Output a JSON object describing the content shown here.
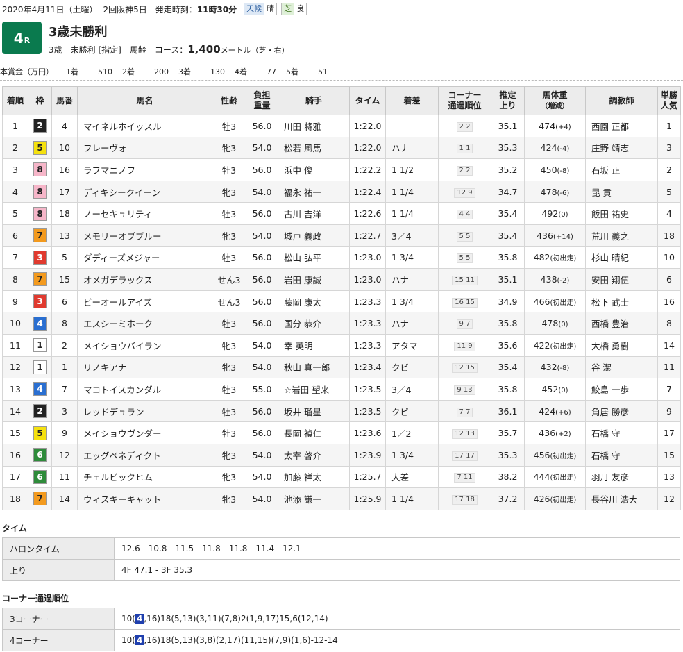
{
  "header": {
    "date": "2020年4月11日（土曜）",
    "meeting": "2回阪神5日",
    "post_time_label": "発走時刻：",
    "post_time": "11時30分",
    "weather_label": "天候",
    "weather": "晴",
    "turf_label": "芝",
    "going": "良"
  },
  "race": {
    "number": "4",
    "suffix": "R",
    "title": "3歳未勝利",
    "conditions": "3歳　未勝利 [指定]　馬齢",
    "course_label": "コース：",
    "distance": "1,400",
    "course_detail": "メートル（芝・右）"
  },
  "prize": {
    "label": "本賞金（万円）",
    "items": [
      {
        "place": "1着",
        "amount": "510"
      },
      {
        "place": "2着",
        "amount": "200"
      },
      {
        "place": "3着",
        "amount": "130"
      },
      {
        "place": "4着",
        "amount": "77"
      },
      {
        "place": "5着",
        "amount": "51"
      }
    ]
  },
  "columns": [
    "着順",
    "枠",
    "馬番",
    "馬名",
    "性齢",
    "負担重量",
    "騎手",
    "タイム",
    "着差",
    "コーナー通過順位",
    "推定上り",
    "馬体重（増減）",
    "調教師",
    "単勝人気"
  ],
  "colors": {
    "waku": {
      "1": {
        "bg": "#ffffff",
        "fg": "#222222"
      },
      "2": {
        "bg": "#222222",
        "fg": "#ffffff"
      },
      "3": {
        "bg": "#e03a2f",
        "fg": "#ffffff"
      },
      "4": {
        "bg": "#2a6fd1",
        "fg": "#ffffff"
      },
      "5": {
        "bg": "#f5e10f",
        "fg": "#222222"
      },
      "6": {
        "bg": "#2e8b3a",
        "fg": "#ffffff"
      },
      "7": {
        "bg": "#f39a1e",
        "fg": "#222222"
      },
      "8": {
        "bg": "#f6b6c9",
        "fg": "#222222"
      }
    },
    "race_badge": "#0a7a4e",
    "highlight": "#1f3fae"
  },
  "results": [
    {
      "pos": "1",
      "waku": "2",
      "num": "4",
      "name": "マイネルホイッスル",
      "sex_age": "牡3",
      "weight": "56.0",
      "jockey": "川田 将雅",
      "time": "1:22.0",
      "margin": "",
      "corner": "2 2",
      "last3f": "35.1",
      "body": "474",
      "diff": "(+4)",
      "trainer": "西園 正都",
      "pop": "1"
    },
    {
      "pos": "2",
      "waku": "5",
      "num": "10",
      "name": "フレーヴォ",
      "sex_age": "牝3",
      "weight": "54.0",
      "jockey": "松若 風馬",
      "time": "1:22.0",
      "margin": "ハナ",
      "corner": "1 1",
      "last3f": "35.3",
      "body": "424",
      "diff": "(-4)",
      "trainer": "庄野 靖志",
      "pop": "3"
    },
    {
      "pos": "3",
      "waku": "8",
      "num": "16",
      "name": "ラフマニノフ",
      "sex_age": "牡3",
      "weight": "56.0",
      "jockey": "浜中 俊",
      "time": "1:22.2",
      "margin": "1 1/2",
      "corner": "2 2",
      "last3f": "35.2",
      "body": "450",
      "diff": "(-8)",
      "trainer": "石坂 正",
      "pop": "2"
    },
    {
      "pos": "4",
      "waku": "8",
      "num": "17",
      "name": "ディキシークイーン",
      "sex_age": "牝3",
      "weight": "54.0",
      "jockey": "福永 祐一",
      "time": "1:22.4",
      "margin": "1 1/4",
      "corner": "12 9",
      "last3f": "34.7",
      "body": "478",
      "diff": "(-6)",
      "trainer": "昆 貢",
      "pop": "5"
    },
    {
      "pos": "5",
      "waku": "8",
      "num": "18",
      "name": "ノーセキュリティ",
      "sex_age": "牡3",
      "weight": "56.0",
      "jockey": "古川 吉洋",
      "time": "1:22.6",
      "margin": "1 1/4",
      "corner": "4 4",
      "last3f": "35.4",
      "body": "492",
      "diff": "(0)",
      "trainer": "飯田 祐史",
      "pop": "4"
    },
    {
      "pos": "6",
      "waku": "7",
      "num": "13",
      "name": "メモリーオブブルー",
      "sex_age": "牝3",
      "weight": "54.0",
      "jockey": "城戸 義政",
      "time": "1:22.7",
      "margin": "3／4",
      "corner": "5 5",
      "last3f": "35.4",
      "body": "436",
      "diff": "(+14)",
      "trainer": "荒川 義之",
      "pop": "18"
    },
    {
      "pos": "7",
      "waku": "3",
      "num": "5",
      "name": "ダディーズメジャー",
      "sex_age": "牡3",
      "weight": "56.0",
      "jockey": "松山 弘平",
      "time": "1:23.0",
      "margin": "1 3/4",
      "corner": "5 5",
      "last3f": "35.8",
      "body": "482",
      "diff": "(初出走)",
      "trainer": "杉山 晴紀",
      "pop": "10"
    },
    {
      "pos": "8",
      "waku": "7",
      "num": "15",
      "name": "オメガデラックス",
      "sex_age": "せん3",
      "weight": "56.0",
      "jockey": "岩田 康誠",
      "time": "1:23.0",
      "margin": "ハナ",
      "corner": "15 11",
      "last3f": "35.1",
      "body": "438",
      "diff": "(-2)",
      "trainer": "安田 翔伍",
      "pop": "6"
    },
    {
      "pos": "9",
      "waku": "3",
      "num": "6",
      "name": "ビーオールアイズ",
      "sex_age": "せん3",
      "weight": "56.0",
      "jockey": "藤岡 康太",
      "time": "1:23.3",
      "margin": "1 3/4",
      "corner": "16 15",
      "last3f": "34.9",
      "body": "466",
      "diff": "(初出走)",
      "trainer": "松下 武士",
      "pop": "16"
    },
    {
      "pos": "10",
      "waku": "4",
      "num": "8",
      "name": "エスシーミホーク",
      "sex_age": "牡3",
      "weight": "56.0",
      "jockey": "国分 恭介",
      "time": "1:23.3",
      "margin": "ハナ",
      "corner": "9 7",
      "last3f": "35.8",
      "body": "478",
      "diff": "(0)",
      "trainer": "西橋 豊治",
      "pop": "8"
    },
    {
      "pos": "11",
      "waku": "1",
      "num": "2",
      "name": "メイショウバイラン",
      "sex_age": "牝3",
      "weight": "54.0",
      "jockey": "幸 英明",
      "time": "1:23.3",
      "margin": "アタマ",
      "corner": "11 9",
      "last3f": "35.6",
      "body": "422",
      "diff": "(初出走)",
      "trainer": "大橋 勇樹",
      "pop": "14"
    },
    {
      "pos": "12",
      "waku": "1",
      "num": "1",
      "name": "リノキアナ",
      "sex_age": "牝3",
      "weight": "54.0",
      "jockey": "秋山 真一郎",
      "time": "1:23.4",
      "margin": "クビ",
      "corner": "12 15",
      "last3f": "35.4",
      "body": "432",
      "diff": "(-8)",
      "trainer": "谷 潔",
      "pop": "11"
    },
    {
      "pos": "13",
      "waku": "4",
      "num": "7",
      "name": "マコトイスカンダル",
      "sex_age": "牡3",
      "weight": "55.0",
      "jockey": "☆岩田 望来",
      "time": "1:23.5",
      "margin": "3／4",
      "corner": "9 13",
      "last3f": "35.8",
      "body": "452",
      "diff": "(0)",
      "trainer": "鮫島 一歩",
      "pop": "7"
    },
    {
      "pos": "14",
      "waku": "2",
      "num": "3",
      "name": "レッドデュラン",
      "sex_age": "牡3",
      "weight": "56.0",
      "jockey": "坂井 瑠星",
      "time": "1:23.5",
      "margin": "クビ",
      "corner": "7 7",
      "last3f": "36.1",
      "body": "424",
      "diff": "(+6)",
      "trainer": "角居 勝彦",
      "pop": "9"
    },
    {
      "pos": "15",
      "waku": "5",
      "num": "9",
      "name": "メイショウヴンダー",
      "sex_age": "牡3",
      "weight": "56.0",
      "jockey": "長岡 禎仁",
      "time": "1:23.6",
      "margin": "1／2",
      "corner": "12 13",
      "last3f": "35.7",
      "body": "436",
      "diff": "(+2)",
      "trainer": "石橋 守",
      "pop": "17"
    },
    {
      "pos": "16",
      "waku": "6",
      "num": "12",
      "name": "エッグベネディクト",
      "sex_age": "牝3",
      "weight": "54.0",
      "jockey": "太宰 啓介",
      "time": "1:23.9",
      "margin": "1 3/4",
      "corner": "17 17",
      "last3f": "35.3",
      "body": "456",
      "diff": "(初出走)",
      "trainer": "石橋 守",
      "pop": "15"
    },
    {
      "pos": "17",
      "waku": "6",
      "num": "11",
      "name": "チェルビックヒム",
      "sex_age": "牝3",
      "weight": "54.0",
      "jockey": "加藤 祥太",
      "time": "1:25.7",
      "margin": "大差",
      "corner": "7 11",
      "last3f": "38.2",
      "body": "444",
      "diff": "(初出走)",
      "trainer": "羽月 友彦",
      "pop": "13"
    },
    {
      "pos": "18",
      "waku": "7",
      "num": "14",
      "name": "ウィスキーキャット",
      "sex_age": "牝3",
      "weight": "54.0",
      "jockey": "池添 謙一",
      "time": "1:25.9",
      "margin": "1 1/4",
      "corner": "17 18",
      "last3f": "37.2",
      "body": "426",
      "diff": "(初出走)",
      "trainer": "長谷川 浩大",
      "pop": "12"
    }
  ],
  "time_section": {
    "title": "タイム",
    "rows": [
      {
        "label": "ハロンタイム",
        "value": "12.6 - 10.8 - 11.5 - 11.8 - 11.8 - 11.4 - 12.1"
      },
      {
        "label": "上り",
        "value": "4F 47.1 - 3F 35.3"
      }
    ]
  },
  "corner_section": {
    "title": "コーナー通過順位",
    "rows": [
      {
        "label": "3コーナー",
        "pre": "10(",
        "hl": "4",
        "post": ",16)18(5,13)(3,11)(7,8)2(1,9,17)15,6(12,14)"
      },
      {
        "label": "4コーナー",
        "pre": "10(",
        "hl": "4",
        "post": ",16)18(5,13)(3,8)(2,17)(11,15)(7,9)(1,6)-12-14"
      }
    ]
  }
}
